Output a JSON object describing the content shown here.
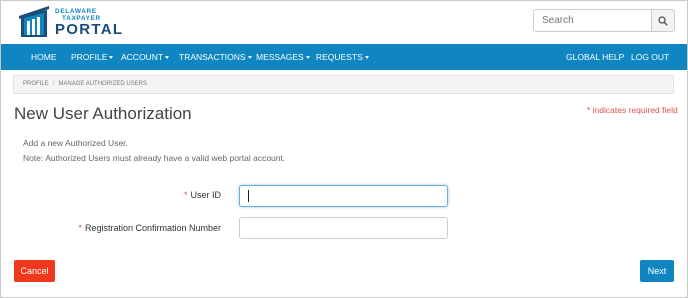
{
  "logo": {
    "line1": "DELAWARE",
    "line2": "TAXPAYER",
    "line3": "PORTAL"
  },
  "search": {
    "placeholder": "Search",
    "icon": "search-icon"
  },
  "nav": {
    "items": [
      {
        "label": "HOME",
        "dropdown": false
      },
      {
        "label": "PROFILE",
        "dropdown": true
      },
      {
        "label": "ACCOUNT",
        "dropdown": true
      },
      {
        "label": "TRANSACTIONS",
        "dropdown": true
      },
      {
        "label": "MESSAGES",
        "dropdown": true
      },
      {
        "label": "REQUESTS",
        "dropdown": true
      }
    ],
    "right_items": [
      {
        "label": "GLOBAL HELP"
      },
      {
        "label": "LOG OUT"
      }
    ],
    "color": "#0f86c2"
  },
  "breadcrumb": {
    "items": [
      "PROFILE",
      "MANAGE AUTHORIZED USERS"
    ],
    "separator": "/"
  },
  "page": {
    "title": "New User Authorization",
    "required_note": "* indicates required field",
    "description": [
      "Add a new Authorized User.",
      "Note: Authorized Users must already have a valid web portal account."
    ]
  },
  "form": {
    "fields": [
      {
        "label": "User ID",
        "required": true,
        "value": ""
      },
      {
        "label": "Registration Confirmation Number",
        "required": true,
        "value": ""
      }
    ]
  },
  "actions": {
    "cancel_label": "Cancel",
    "next_label": "Next",
    "cancel_color": "#f0381c",
    "next_color": "#0f86c2"
  }
}
